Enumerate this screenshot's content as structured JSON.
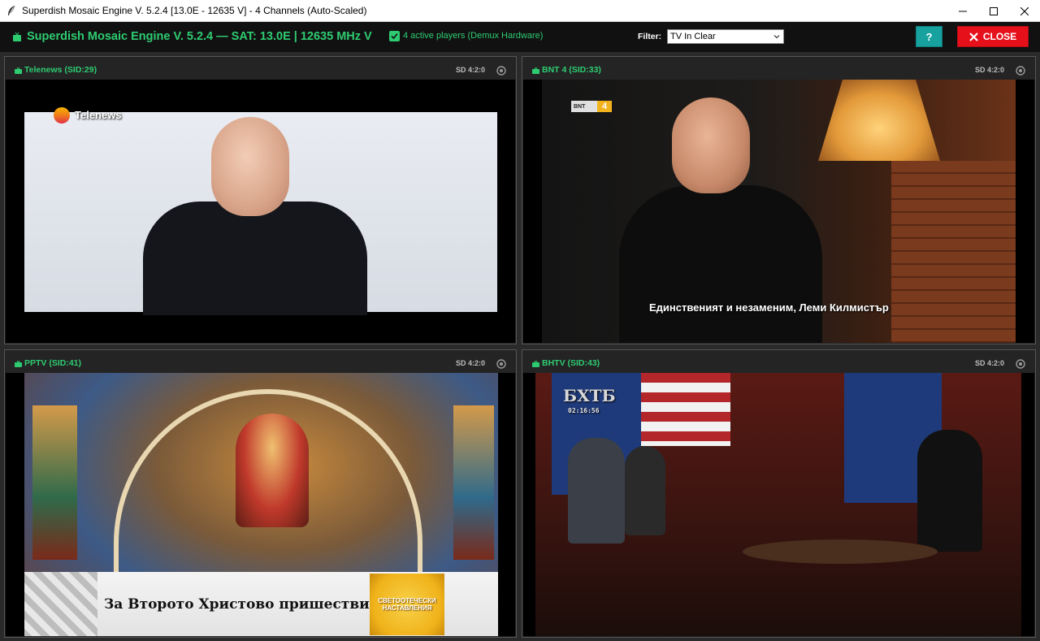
{
  "window": {
    "title": "Superdish Mosaic Engine V. 5.2.4 [13.0E - 12635 V] - 4 Channels (Auto-Scaled)"
  },
  "header": {
    "headline": "Superdish Mosaic Engine V. 5.2.4  —  SAT: 13.0E   |   12635 MHz V",
    "players_label": "4 active players (Demux Hardware)",
    "players_checked": true,
    "filter_label": "Filter:",
    "filter_value": "TV In Clear",
    "help_label": "?",
    "close_label": "CLOSE",
    "accent_color": "#2ecc71",
    "close_color": "#e5101a",
    "help_color": "#17a2a0"
  },
  "channels": [
    {
      "name": "Telenews (SID:29)",
      "format": "SD 4:2:0",
      "overlay": "Telenews"
    },
    {
      "name": "BNT 4 (SID:33)",
      "format": "SD 4:2:0",
      "overlay": "BNT 4",
      "subtitle": "Единственият и незаменим, Леми Килмистър"
    },
    {
      "name": "PPTV (SID:41)",
      "format": "SD 4:2:0",
      "overlay": "За Второто Христово пришествие",
      "badge": "СВЕТООТЕЧЕСКИ НАСТАВЛЕНИЯ"
    },
    {
      "name": "BHTV (SID:43)",
      "format": "SD 4:2:0",
      "overlay": "БХТБ",
      "clock": "02:16:56"
    }
  ]
}
